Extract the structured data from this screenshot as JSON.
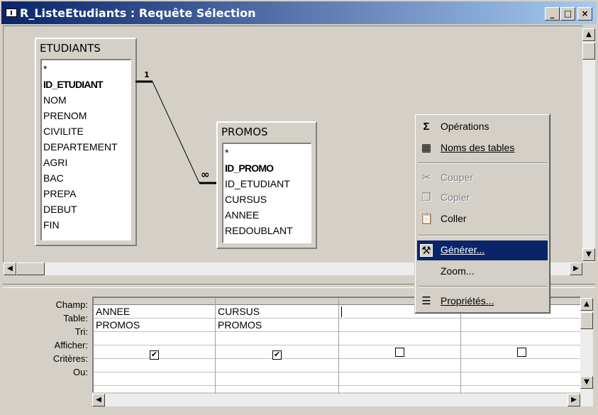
{
  "window": {
    "title": "R_ListeEtudiants : Requête Sélection",
    "controls": {
      "minimize": "_",
      "maximize": "□",
      "close": "×"
    }
  },
  "tables": [
    {
      "name": "ETUDIANTS",
      "fields": [
        "*",
        "ID_ETUDIANT",
        "NOM",
        "PRENOM",
        "CIVILITE",
        "DEPARTEMENT",
        "AGRI",
        "BAC",
        "PREPA",
        "DEBUT",
        "FIN"
      ],
      "key": "ID_ETUDIANT"
    },
    {
      "name": "PROMOS",
      "fields": [
        "*",
        "ID_PROMO",
        "ID_ETUDIANT",
        "CURSUS",
        "ANNEE",
        "REDOUBLANT"
      ],
      "key": "ID_PROMO"
    }
  ],
  "relationship": {
    "one_label": "1",
    "many_label": "∞"
  },
  "grid": {
    "row_labels": [
      "Champ:",
      "Table:",
      "Tri:",
      "Afficher:",
      "Critères:",
      "Ou:"
    ],
    "columns": [
      {
        "champ": "ANNEE",
        "table": "PROMOS",
        "tri": "",
        "afficher": true,
        "criteres": "",
        "ou": ""
      },
      {
        "champ": "CURSUS",
        "table": "PROMOS",
        "tri": "",
        "afficher": true,
        "criteres": "",
        "ou": ""
      },
      {
        "champ": "",
        "table": "",
        "tri": "",
        "afficher": false,
        "criteres": "",
        "ou": ""
      },
      {
        "champ": "",
        "table": "",
        "tri": "",
        "afficher": false,
        "criteres": "",
        "ou": ""
      }
    ]
  },
  "context_menu": {
    "items": [
      {
        "label": "Opérations",
        "icon": "sigma-icon",
        "glyph": "Σ",
        "enabled": true
      },
      {
        "label": "Noms des tables",
        "icon": "table-names-icon",
        "glyph": "▦",
        "enabled": true
      },
      {
        "label": "Couper",
        "icon": "scissors-icon",
        "glyph": "✂",
        "enabled": false
      },
      {
        "label": "Copier",
        "icon": "copy-icon",
        "glyph": "❐",
        "enabled": false
      },
      {
        "label": "Coller",
        "icon": "paste-icon",
        "glyph": "📋",
        "enabled": true
      },
      {
        "label": "Générer...",
        "icon": "wand-icon",
        "glyph": "⚒",
        "enabled": true,
        "highlighted": true
      },
      {
        "label": "Zoom...",
        "icon": "",
        "glyph": "",
        "enabled": true
      },
      {
        "label": "Propriétés...",
        "icon": "properties-icon",
        "glyph": "☰",
        "enabled": true
      }
    ]
  },
  "colors": {
    "titlebar_start": "#0a246a",
    "titlebar_end": "#a6caf0",
    "highlight": "#0a246a",
    "face": "#d4d0c8"
  }
}
